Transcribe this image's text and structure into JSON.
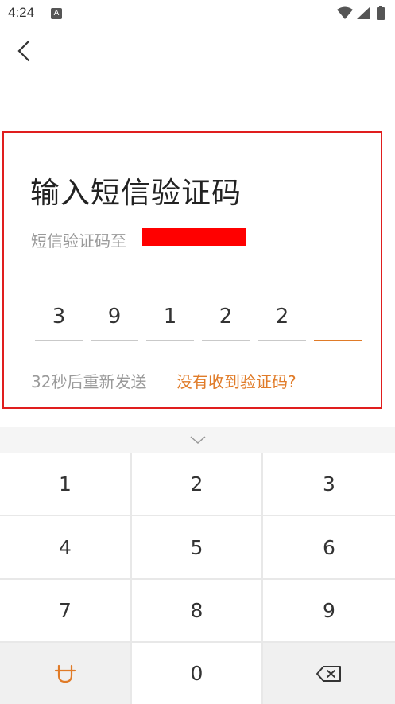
{
  "status_bar": {
    "time": "4:24",
    "notification_letter": "A"
  },
  "header": {
    "back_icon": "chevron-left-icon"
  },
  "main": {
    "title": "输入短信验证码",
    "subtitle_prefix": "短信验证码至",
    "code_digits": [
      "3",
      "9",
      "1",
      "2",
      "2",
      ""
    ],
    "resend_countdown": "32秒后重新发送",
    "no_code_link": "没有收到验证码?"
  },
  "keyboard": {
    "collapse_icon": "chevron-down-icon",
    "keys": [
      "1",
      "2",
      "3",
      "4",
      "5",
      "6",
      "7",
      "8",
      "9",
      "",
      "0",
      ""
    ],
    "special_left_icon": "input-method-icon",
    "special_right_icon": "backspace-icon"
  },
  "colors": {
    "accent": "#e07b28",
    "highlight_border": "#e01e1e",
    "redaction": "#ff0000"
  }
}
